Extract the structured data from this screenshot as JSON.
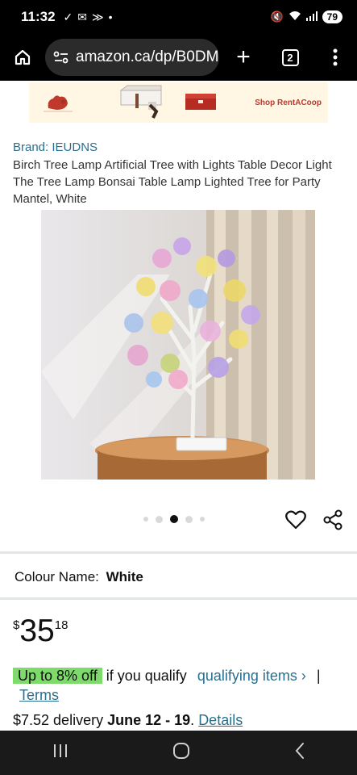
{
  "status_bar": {
    "time": "11:32",
    "battery": "79"
  },
  "browser": {
    "url": "amazon.ca/dp/B0DM",
    "tab_count": "2"
  },
  "ad": {
    "brand_text": "Shop RentACoop"
  },
  "product": {
    "brand": "Brand: IEUDNS",
    "title": "Birch Tree Lamp Artificial Tree with Lights Table Decor Light The Tree Lamp Bonsai Table Lamp Lighted Tree for Party Mantel, White",
    "image_count": 5,
    "active_image_index": 2
  },
  "colour": {
    "label": "Colour Name:",
    "value": "White"
  },
  "price": {
    "symbol": "$",
    "whole": "35",
    "fraction": "18"
  },
  "offer": {
    "badge": "Up to 8% off",
    "qualify_text": "if you qualify",
    "link": "qualifying items ›",
    "separator": "|",
    "terms": "Terms"
  },
  "delivery": {
    "price_text": "$7.52 delivery",
    "date": "June 12 - 19",
    "period": ".",
    "details": "Details"
  },
  "colors": {
    "link": "#2a6f8f",
    "offer_badge": "#7fda6c",
    "status_bar": "#000000",
    "nav_bar": "#1a1a1a"
  }
}
